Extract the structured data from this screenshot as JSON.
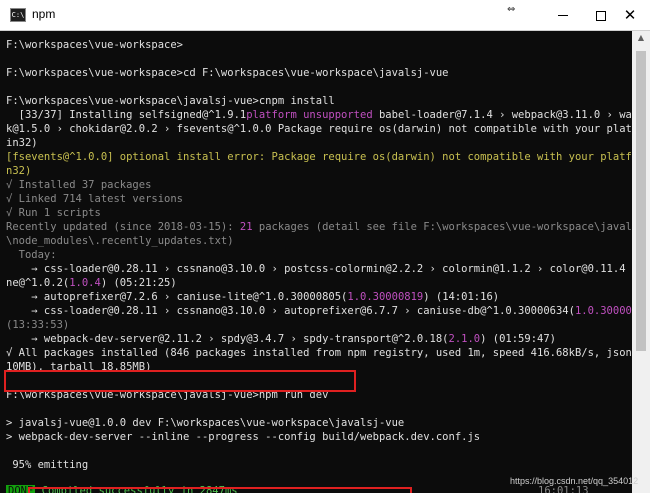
{
  "window": {
    "title": "npm",
    "app_icon": "cmd-icon",
    "controls": [
      "minimize-icon",
      "maximize-icon",
      "close-icon"
    ],
    "close_glyph": "✕",
    "resize_glyph": "⇔"
  },
  "console": {
    "lines": [
      {
        "text": "F:\\workspaces\\vue-workspace>",
        "color": "white"
      },
      {
        "text": "",
        "color": "white"
      },
      {
        "text": "F:\\workspaces\\vue-workspace>cd F:\\workspaces\\vue-workspace\\javalsj-vue",
        "color": "white"
      },
      {
        "text": "",
        "color": "white"
      },
      {
        "text": "F:\\workspaces\\vue-workspace\\javalsj-vue>cnpm install",
        "color": "white"
      },
      {
        "text": "  [33/37] Installing selfsigned@^1.9.1platform unsupported babel-loader@7.1.4 › webpack@3.11.0 › watchpac",
        "color": "white"
      },
      {
        "text": "k@1.5.0 › chokidar@2.0.2 › fsevents@^1.0.0 Package require os(darwin) not compatible with your platform(w",
        "color": "white"
      },
      {
        "text": "in32)",
        "color": "white"
      },
      {
        "text": "[fsevents@^1.0.0] optional install error: Package require os(darwin) not compatible with your platform(wi",
        "color": "yellow"
      },
      {
        "text": "n32)",
        "color": "yellow"
      },
      {
        "text": "√ Installed 37 packages",
        "color": "grey"
      },
      {
        "text": "√ Linked 714 latest versions",
        "color": "grey"
      },
      {
        "text": "√ Run 1 scripts",
        "color": "grey"
      },
      {
        "text": "Recently updated (since 2018-03-15): 21 packages (detail see file F:\\workspaces\\vue-workspace\\javalsj-vue",
        "color": "grey"
      },
      {
        "text": "\\node_modules\\.recently_updates.txt)",
        "color": "grey"
      },
      {
        "text": "  Today:",
        "color": "grey"
      },
      {
        "text": "    → css-loader@0.28.11 › cssnano@3.10.0 › postcss-colormin@2.2.2 › colormin@1.1.2 › color@0.11.4 › clo",
        "color": "white"
      },
      {
        "text": "ne@^1.0.2(1.0.4) (05:21:25)",
        "color": "white"
      },
      {
        "text": "    → autoprefixer@7.2.6 › caniuse-lite@^1.0.30000805(1.0.30000819) (14:01:16)",
        "color": "white"
      },
      {
        "text": "    → css-loader@0.28.11 › cssnano@3.10.0 › autoprefixer@6.7.7 › caniuse-db@^1.0.30000634(1.0.30000819)",
        "color": "white"
      },
      {
        "text": "(13:33:53)",
        "color": "grey"
      },
      {
        "text": "    → webpack-dev-server@2.11.2 › spdy@3.4.7 › spdy-transport@^2.0.18(2.1.0) (01:59:47)",
        "color": "white"
      },
      {
        "text": "√ All packages installed (846 packages installed from npm registry, used 1m, speed 416.68kB/s, json 751(",
        "color": "white"
      },
      {
        "text": "10MB), tarball 18.85MB)",
        "color": "white"
      },
      {
        "text": "",
        "color": "white"
      },
      {
        "text": "F:\\workspaces\\vue-workspace\\javalsj-vue>npm run dev",
        "color": "white"
      },
      {
        "text": "",
        "color": "white"
      },
      {
        "text": "> javalsj-vue@1.0.0 dev F:\\workspaces\\vue-workspace\\javalsj-vue",
        "color": "white"
      },
      {
        "text": "> webpack-dev-server --inline --progress --config build/webpack.dev.conf.js",
        "color": "white"
      },
      {
        "text": "",
        "color": "white"
      },
      {
        "text": " 95% emitting",
        "color": "white"
      },
      {
        "text": "",
        "color": "white"
      }
    ],
    "done_badge": "DONE",
    "done_message": " Compiled successfully in 2847ms",
    "done_time": "16:01:13"
  },
  "watermark": "https://blog.csdn.net/qq_354012"
}
